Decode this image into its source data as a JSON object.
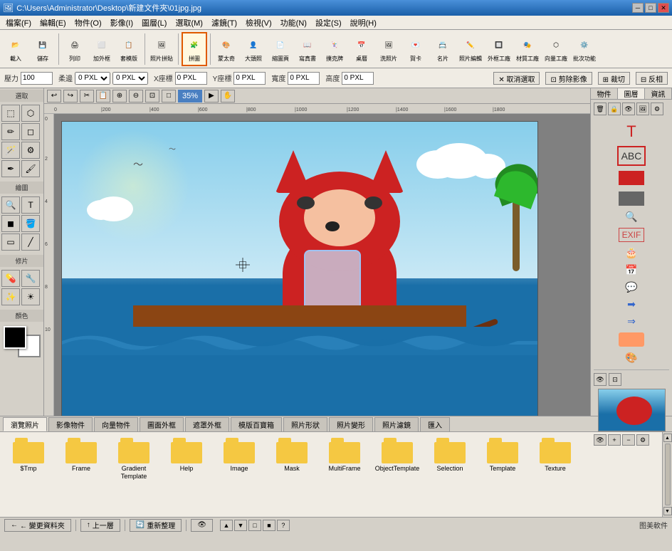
{
  "titlebar": {
    "title": "C:\\Users\\Administrator\\Desktop\\新建文件夾\\01jpg.jpg",
    "min_btn": "─",
    "max_btn": "□",
    "close_btn": "✕"
  },
  "menubar": {
    "items": [
      "檔案(F)",
      "編輯(E)",
      "物件(O)",
      "影像(I)",
      "圖層(L)",
      "選取(M)",
      "濾鏡(T)",
      "檢視(V)",
      "功能(N)",
      "設定(S)",
      "說明(H)"
    ]
  },
  "toolbar": {
    "tools": [
      {
        "label": "載入",
        "icon": "📂"
      },
      {
        "label": "儲存",
        "icon": "💾"
      },
      {
        "label": "列印",
        "icon": "🖨"
      },
      {
        "label": "加外框",
        "icon": "⬜"
      },
      {
        "label": "套模版",
        "icon": "📋"
      },
      {
        "label": "照片拼貼",
        "icon": "🖼"
      },
      {
        "label": "拼圖",
        "icon": "🧩",
        "active": true
      },
      {
        "label": "蒙太奇",
        "icon": "🎨"
      },
      {
        "label": "大頭照",
        "icon": "👤"
      },
      {
        "label": "縮圖頁",
        "icon": "📄"
      },
      {
        "label": "寫真書",
        "icon": "📖"
      },
      {
        "label": "撲克牌",
        "icon": "🃏"
      },
      {
        "label": "桌曆",
        "icon": "📅"
      },
      {
        "label": "洗照片",
        "icon": "🖼"
      },
      {
        "label": "賀卡",
        "icon": "💌"
      },
      {
        "label": "名片",
        "icon": "📇"
      },
      {
        "label": "照片編輯",
        "icon": "✏️"
      },
      {
        "label": "外框工廠",
        "icon": "🔲"
      },
      {
        "label": "材質工廠",
        "icon": "🎭"
      },
      {
        "label": "向量工廠",
        "icon": "⬡"
      },
      {
        "label": "批次功能",
        "icon": "⚙️"
      }
    ]
  },
  "optionsbar": {
    "pressure_label": "壓力",
    "pressure_value": "100",
    "smooth_label": "柔邊",
    "smooth_value": "0",
    "x_label": "X座標",
    "x_value": "0",
    "y_label": "Y座標",
    "y_value": "0",
    "width_label": "寬度",
    "width_value": "0",
    "height_label": "高度",
    "height_value": "0",
    "cancel_btn": "✕ 取消選取",
    "remove_btn": "⊡ 剪除影像",
    "crop_btn": "⊞ 裁切",
    "reverse_btn": "⊟ 反相"
  },
  "navbars": {
    "zoom_label": "35%",
    "tools": [
      "↩",
      "↪",
      "✂",
      "📋",
      "⊕",
      "⊖",
      "⊡",
      "□",
      "35%",
      "▶",
      "↕"
    ]
  },
  "left_tools": {
    "sections": [
      {
        "label": "選取",
        "tools": [
          [
            "⬚",
            "⬡"
          ],
          [
            "✏",
            "◻"
          ],
          [
            "🪄",
            "⚙"
          ],
          [
            "✒",
            "🖌"
          ],
          [
            "🔍",
            "🖊"
          ]
        ]
      },
      {
        "label": "繪圖",
        "tools": [
          [
            "✏",
            "◻"
          ],
          [
            "📝",
            "🖍"
          ],
          [
            "💧",
            "🪣"
          ],
          [
            "🔲",
            "⬛"
          ]
        ]
      },
      {
        "label": "修片",
        "tools": [
          [
            "💊",
            "🔧"
          ],
          [
            "✨",
            "🎨"
          ]
        ]
      },
      {
        "label": "顏色",
        "tools": []
      }
    ]
  },
  "canvas": {
    "ruler_marks_h": [
      "0",
      "|200",
      "|400",
      "|600",
      "|800",
      "|1000",
      "|1200",
      "|1400",
      "|1600",
      "|1800"
    ],
    "ruler_marks_v": [
      "0",
      "2",
      "4",
      "6",
      "8",
      "10"
    ],
    "zoom": "35%"
  },
  "right_panel": {
    "tabs": [
      "物件",
      "圖層",
      "資訊"
    ],
    "active_tab": "圖層",
    "tools": [
      "🗑",
      "🔒",
      "👁",
      "🖼",
      "⚙"
    ],
    "icons": [
      {
        "label": "T",
        "type": "text"
      },
      {
        "label": "ABC",
        "type": "text2"
      },
      {
        "label": "▮",
        "type": "color"
      },
      {
        "label": "⬚",
        "type": "frame"
      },
      {
        "label": "🔍",
        "type": "zoom"
      },
      {
        "label": "🕐",
        "type": "time"
      },
      {
        "label": "EXIF",
        "type": "exif"
      },
      {
        "label": "🎂",
        "type": "cake"
      },
      {
        "label": "📅",
        "type": "cal"
      },
      {
        "label": "💬",
        "type": "speech"
      },
      {
        "label": "→",
        "type": "arrow1"
      },
      {
        "label": "⇒",
        "type": "arrow2"
      },
      {
        "label": "⬡",
        "type": "shape"
      },
      {
        "label": "🎨",
        "type": "palette"
      },
      {
        "label": "👁",
        "type": "eye"
      },
      {
        "label": "⊡",
        "type": "clip"
      }
    ]
  },
  "bottom_tabs": {
    "tabs": [
      "瀏覽照片",
      "影像物件",
      "向量物件",
      "圖面外框",
      "遮罩外框",
      "模版百寶箱",
      "照片形狀",
      "照片變形",
      "照片濾鏡",
      "匯入"
    ],
    "active_tab": "瀏覽照片"
  },
  "folder_browser": {
    "folders": [
      {
        "label": "$Tmp"
      },
      {
        "label": "Frame"
      },
      {
        "label": "Gradient\nTemplate"
      },
      {
        "label": "Help"
      },
      {
        "label": "Image"
      },
      {
        "label": "Mask"
      },
      {
        "label": "MultiFrame"
      },
      {
        "label": "ObjectTemplate"
      },
      {
        "label": "Selection"
      },
      {
        "label": "Template"
      },
      {
        "label": "Texture"
      }
    ]
  },
  "statusbar": {
    "nav_btn": "← 變更資料夾",
    "up_btn": "↑ 上一層",
    "refresh_btn": "🔄 重新整理",
    "show_icon": "👁",
    "sort_icons": [
      "▲",
      "▼",
      "□",
      "■",
      "?"
    ]
  }
}
